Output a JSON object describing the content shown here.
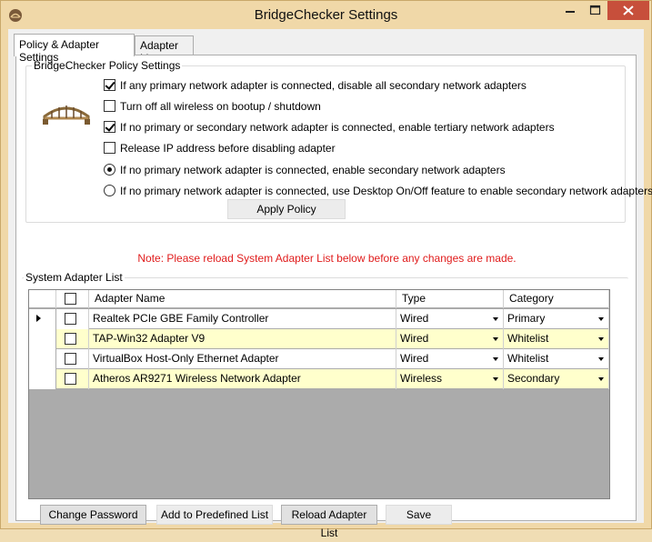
{
  "window": {
    "title": "BridgeChecker Settings",
    "icon": "bridge-app-icon",
    "controls": [
      "minimize-icon",
      "maximize-icon",
      "close-icon"
    ],
    "accent_color": "#f0d8a8",
    "close_color": "#c74f3b"
  },
  "tabs": [
    {
      "label": "Policy & Adapter Settings",
      "active": true
    },
    {
      "label": "Adapter List",
      "active": false
    }
  ],
  "policy": {
    "group_title": "BridgeChecker Policy Settings",
    "image_icon": "bridge-image",
    "options": [
      {
        "type": "checkbox",
        "checked": true,
        "label": "If any primary network adapter is connected, disable all secondary network adapters"
      },
      {
        "type": "checkbox",
        "checked": false,
        "label": "Turn off all wireless on bootup / shutdown"
      },
      {
        "type": "checkbox",
        "checked": true,
        "label": "If no primary or secondary network adapter is connected, enable tertiary network adapters"
      },
      {
        "type": "checkbox",
        "checked": false,
        "label": "Release IP address before disabling adapter"
      },
      {
        "type": "radio",
        "checked": true,
        "label": "If no primary network adapter is connected, enable secondary network adapters"
      },
      {
        "type": "radio",
        "checked": false,
        "label": "If no primary network adapter is connected, use Desktop On/Off feature to enable secondary network adapters"
      }
    ],
    "apply_label": "Apply Policy"
  },
  "note": "Note: Please reload System Adapter List below before any changes are made.",
  "adapters": {
    "group_title": "System Adapter List",
    "columns": [
      "Adapter Name",
      "Type",
      "Category"
    ],
    "rows": [
      {
        "name": "Realtek PCIe GBE Family Controller",
        "type": "Wired",
        "category": "Primary",
        "selected": true
      },
      {
        "name": "TAP-Win32 Adapter V9",
        "type": "Wired",
        "category": "Whitelist",
        "selected": false
      },
      {
        "name": "VirtualBox Host-Only Ethernet Adapter",
        "type": "Wired",
        "category": "Whitelist",
        "selected": false
      },
      {
        "name": "Atheros AR9271 Wireless Network Adapter",
        "type": "Wireless",
        "category": "Secondary",
        "selected": false
      }
    ],
    "highlight_color": "#ffffcc"
  },
  "buttons": {
    "change_password": "Change Password",
    "add_predefined": "Add to Predefined List",
    "reload": "Reload Adapter List",
    "save": "Save"
  }
}
